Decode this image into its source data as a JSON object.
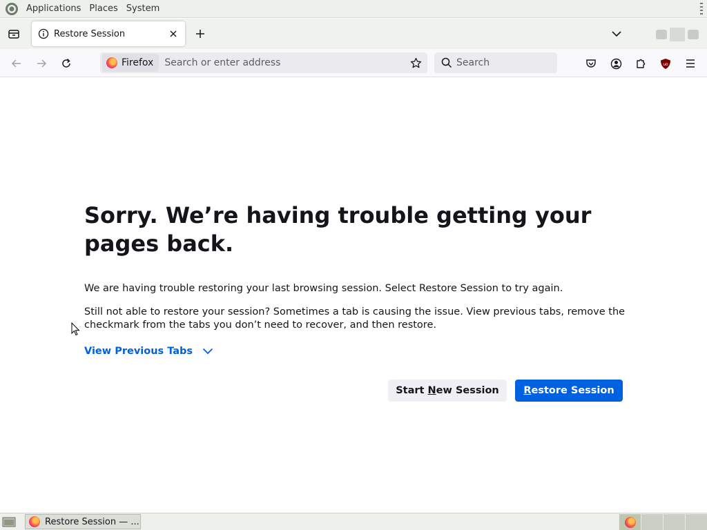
{
  "top_panel": {
    "menus": [
      "Applications",
      "Places",
      "System"
    ]
  },
  "tabs": {
    "active": {
      "title": "Restore Session"
    }
  },
  "navbar": {
    "identity_label": "Firefox",
    "url_placeholder": "Search or enter address",
    "search_placeholder": "Search"
  },
  "content": {
    "title": "Sorry. We’re having trouble getting your pages back.",
    "para1": "We are having trouble restoring your last browsing session. Select Restore Session to try again.",
    "para2": "Still not able to restore your session? Sometimes a tab is causing the issue. View previous tabs, remove the checkmark from the tabs you don’t need to recover, and then restore.",
    "view_tabs_label": "View Previous Tabs",
    "start_new_prefix": "Start ",
    "start_new_accel": "N",
    "start_new_suffix": "ew Session",
    "restore_accel": "R",
    "restore_suffix": "estore Session"
  },
  "taskbar": {
    "task_label": "Restore Session — ..."
  },
  "colors": {
    "accent": "#0061e0",
    "panel_bg": "#eef0ec"
  }
}
